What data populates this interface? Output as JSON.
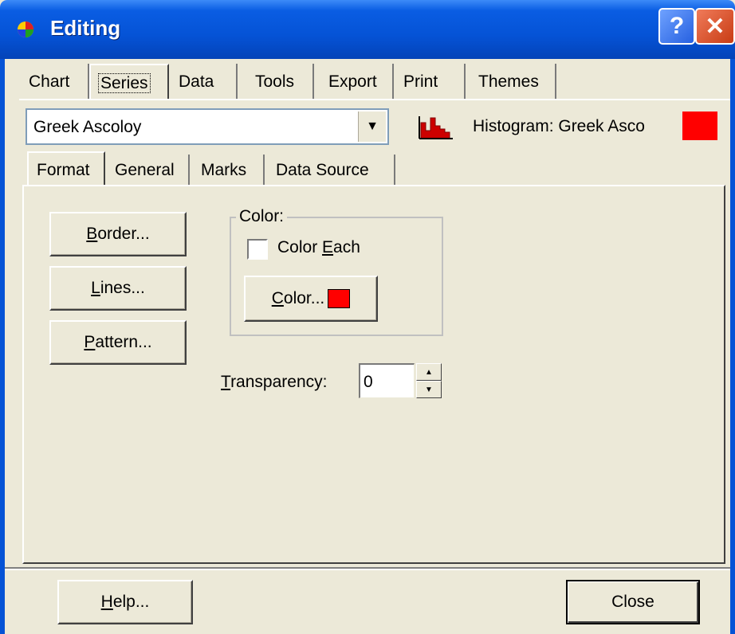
{
  "window": {
    "title": "Editing",
    "help_glyph": "?",
    "close_glyph": "✕"
  },
  "tabs": [
    {
      "label": "Chart"
    },
    {
      "label": "Series"
    },
    {
      "label": "Data"
    },
    {
      "label": "Tools"
    },
    {
      "label": "Export"
    },
    {
      "label": "Print"
    },
    {
      "label": "Themes"
    }
  ],
  "series_select": {
    "value": "Greek Ascoloy"
  },
  "series_info": {
    "title": "Histogram: Greek Asco",
    "color": "#ff0000"
  },
  "subtabs": [
    {
      "label": "Format"
    },
    {
      "label": "General"
    },
    {
      "label": "Marks"
    },
    {
      "label": "Data Source"
    }
  ],
  "format": {
    "border_button": {
      "mnemonic": "B",
      "rest": "order..."
    },
    "lines_button": {
      "mnemonic": "L",
      "rest": "ines..."
    },
    "pattern_button": {
      "mnemonic": "P",
      "rest": "attern..."
    },
    "color_group": {
      "label": "Color:",
      "color_each": {
        "before": "Color ",
        "mnemonic": "E",
        "after": "ach",
        "checked": false
      },
      "color_button": {
        "mnemonic": "C",
        "rest": "olor..."
      }
    },
    "transparency": {
      "mnemonic": "T",
      "rest": "ransparency:",
      "value": "0"
    }
  },
  "footer": {
    "help_button": {
      "mnemonic": "H",
      "rest": "elp..."
    },
    "close_button": "Close"
  }
}
